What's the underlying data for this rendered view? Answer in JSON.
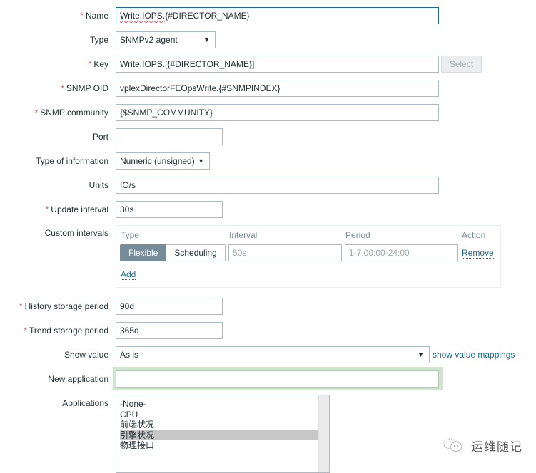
{
  "form": {
    "name": {
      "label": "Name",
      "required": "*",
      "value": "Write.IOPS.{#DIRECTOR_NAME}",
      "value_spell": "Write.IOPS.",
      "value_rest": "{#DIRECTOR_NAME}"
    },
    "type": {
      "label": "Type",
      "value": "SNMPv2 agent"
    },
    "key": {
      "label": "Key",
      "required": "*",
      "value": "Write.IOPS.[{#DIRECTOR_NAME}]",
      "select_button": "Select"
    },
    "snmp_oid": {
      "label": "SNMP OID",
      "required": "*",
      "value": "vplexDirectorFEOpsWrite.{#SNMPINDEX}"
    },
    "snmp_community": {
      "label": "SNMP community",
      "required": "*",
      "value": "{$SNMP_COMMUNITY}"
    },
    "port": {
      "label": "Port",
      "value": ""
    },
    "type_of_information": {
      "label": "Type of information",
      "value": "Numeric (unsigned)"
    },
    "units": {
      "label": "Units",
      "value": "IO/s"
    },
    "update_interval": {
      "label": "Update interval",
      "required": "*",
      "value": "30s"
    },
    "custom_intervals": {
      "label": "Custom intervals",
      "headers": {
        "type": "Type",
        "interval": "Interval",
        "period": "Period",
        "action": "Action"
      },
      "rows": [
        {
          "type_options": [
            "Flexible",
            "Scheduling"
          ],
          "type_selected": "Flexible",
          "interval_placeholder": "50s",
          "period_placeholder": "1-7,00:00-24:00",
          "action": "Remove"
        }
      ],
      "add_link": "Add"
    },
    "history_storage_period": {
      "label": "History storage period",
      "required": "*",
      "value": "90d"
    },
    "trend_storage_period": {
      "label": "Trend storage period",
      "required": "*",
      "value": "365d"
    },
    "show_value": {
      "label": "Show value",
      "value": "As is",
      "link": "show value mappings"
    },
    "new_application": {
      "label": "New application",
      "value": ""
    },
    "applications": {
      "label": "Applications",
      "options": [
        "-None-",
        "CPU",
        "前端状况",
        "引擎状况",
        "物理接口"
      ],
      "selected": "引擎状况"
    }
  },
  "watermark": {
    "text": "运维随记"
  },
  "icons": {
    "dropdown": "▼"
  }
}
